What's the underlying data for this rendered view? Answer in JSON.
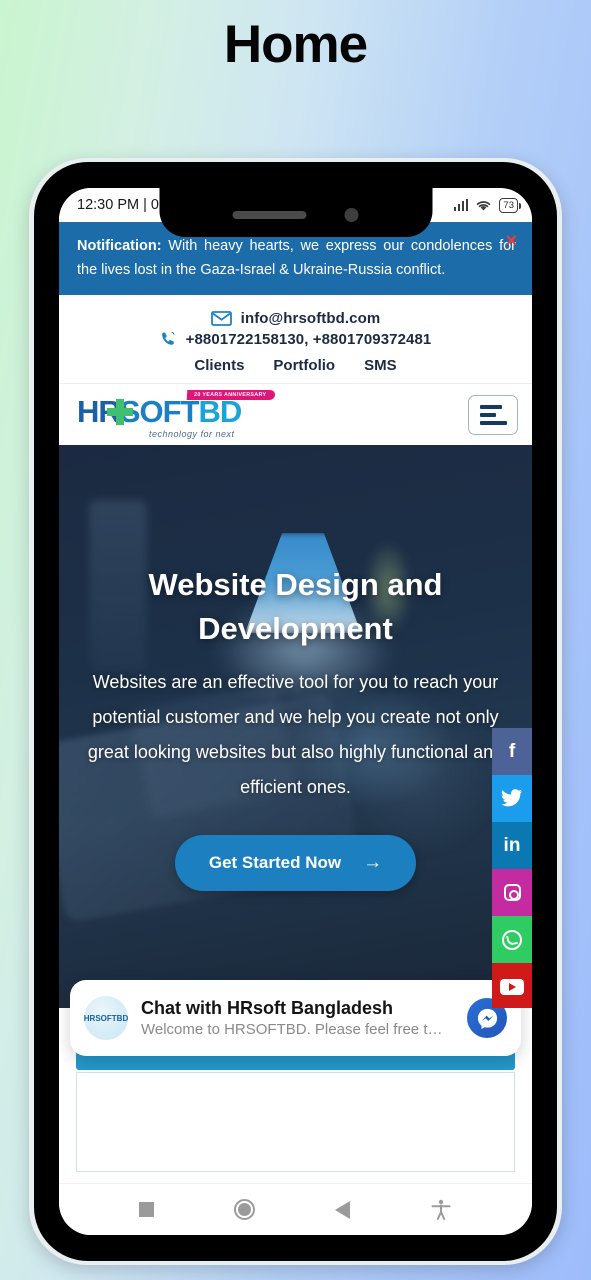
{
  "page": {
    "title": "Home"
  },
  "status_bar": {
    "time": "12:30 PM | 0",
    "battery_level": "73",
    "signal_icon": "signal-bars-icon",
    "wifi_icon": "wifi-icon"
  },
  "notification": {
    "label": "Notification:",
    "message": " With heavy hearts, we express our condolences for the lives lost in the Gaza-Israel & Ukraine-Russia conflict.",
    "close_icon": "✕",
    "close_color": "#ef3b3b",
    "background": "#1b6ca8"
  },
  "contact_bar": {
    "email": "info@hrsoftbd.com",
    "phones": "+8801722158130, +8801709372481",
    "links": [
      {
        "label": "Clients"
      },
      {
        "label": "Portfolio"
      },
      {
        "label": "SMS"
      }
    ]
  },
  "logo": {
    "part_h": "H",
    "part_r": "R",
    "part_soft": "SOFT",
    "part_bd": "BD",
    "ribbon": "20 YEARS ANNIVERSARY",
    "tagline": "technology for next"
  },
  "menu": {
    "name": "hamburger-menu"
  },
  "hero": {
    "title": "Website Design and Development",
    "body": "Websites are an effective tool for you to reach your potential customer and we help you create not only great looking websites but also highly functional and efficient ones.",
    "cta_label": "Get Started Now",
    "cta_arrow": "→",
    "cta_color": "#1b7fc0"
  },
  "social": [
    {
      "name": "facebook",
      "glyph": "f",
      "color": "#4d6296"
    },
    {
      "name": "twitter",
      "glyph": "",
      "color": "#1c9cec"
    },
    {
      "name": "linkedin",
      "glyph": "in",
      "color": "#0b78b3"
    },
    {
      "name": "instagram",
      "glyph": "",
      "color": "#c42ba0"
    },
    {
      "name": "whatsapp",
      "glyph": "",
      "color": "#2ecc63"
    },
    {
      "name": "youtube",
      "glyph": "",
      "color": "#d01919"
    }
  ],
  "chat": {
    "avatar_text": "HRSOFTBD",
    "title": "Chat with HRsoft Bangladesh",
    "subtitle": "Welcome to HRSOFTBD. Please feel free t…",
    "messenger_icon": "messenger-icon"
  },
  "android_nav": {
    "recents": "recents-square-icon",
    "home": "home-circle-icon",
    "back": "back-triangle-icon",
    "accessibility": "accessibility-icon"
  }
}
